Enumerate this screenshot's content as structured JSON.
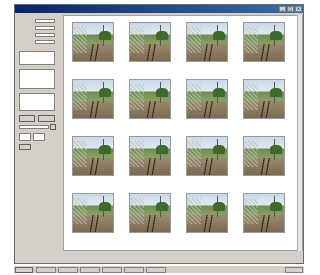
{
  "window": {
    "title": "",
    "title_buttons": [
      "_",
      "□",
      "×"
    ]
  },
  "panel": {
    "fields": [
      {
        "label": "",
        "value": ""
      },
      {
        "label": "",
        "value": ""
      },
      {
        "label": "",
        "value": ""
      },
      {
        "label": "",
        "value": ""
      }
    ],
    "buttons": [
      "",
      "",
      ""
    ]
  },
  "thumbnails": [
    {
      "caption": ""
    },
    {
      "caption": ""
    },
    {
      "caption": ""
    },
    {
      "caption": ""
    },
    {
      "caption": ""
    },
    {
      "caption": ""
    },
    {
      "caption": ""
    },
    {
      "caption": ""
    },
    {
      "caption": ""
    },
    {
      "caption": ""
    },
    {
      "caption": ""
    },
    {
      "caption": ""
    },
    {
      "caption": ""
    },
    {
      "caption": ""
    },
    {
      "caption": ""
    },
    {
      "caption": ""
    }
  ],
  "taskbar": {
    "start_label": "",
    "tasks": [
      "",
      "",
      "",
      "",
      "",
      ""
    ],
    "clock": ""
  }
}
